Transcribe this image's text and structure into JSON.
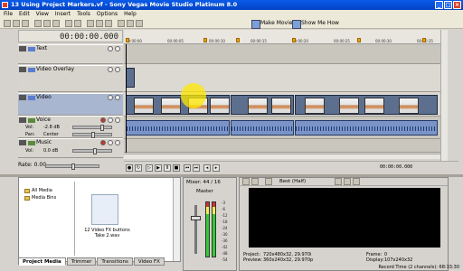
{
  "window": {
    "title": "13 Using Project Markers.vf - Sony Vegas Movie Studio Platinum 8.0",
    "accent": "#0a5be8"
  },
  "menu": [
    "File",
    "Edit",
    "View",
    "Insert",
    "Tools",
    "Options",
    "Help"
  ],
  "toolbar": {
    "make_movie": "Make Movie",
    "show_me_how": "Show Me How"
  },
  "timecode": "00:00:00.000",
  "ruler_labels": [
    "00:00:00",
    "00:00:05",
    "00:00:10",
    "00:00:15",
    "00:00:20",
    "00:00:25",
    "00:00:30",
    "00:00:35"
  ],
  "tracks": [
    {
      "name": "Text",
      "type": "video"
    },
    {
      "name": "Video Overlay",
      "type": "video"
    },
    {
      "name": "Video",
      "type": "video"
    },
    {
      "name": "Voice",
      "type": "audio",
      "vol_label": "Vol:",
      "vol_value": "-2.8 dB",
      "pan_label": "Pan:",
      "pan_value": "Center"
    },
    {
      "name": "Music",
      "type": "audio",
      "vol_label": "Vol:",
      "vol_value": "0.0 dB"
    }
  ],
  "rate": "Rate: 0.00",
  "transport_time": "00:00:00.000",
  "media": {
    "tree": [
      "All Media",
      "Media Bins"
    ],
    "file_caption_1": "12 Video FX buttons",
    "file_caption_2": "Take 2.wav"
  },
  "mixer": {
    "title": "Mixer: 44 / 16",
    "master": "Master",
    "db_marks": [
      "-3",
      "-6",
      "-12",
      "-18",
      "-24",
      "-30",
      "-36",
      "-42",
      "-48",
      "-54"
    ]
  },
  "preview": {
    "quality": "Best (Half)",
    "project_label": "Project:",
    "project_value": "720x480x32, 29.970i",
    "preview_label": "Preview:",
    "preview_value": "360x240x32, 29.970p",
    "frame_label": "Frame:",
    "frame_value": "0",
    "display_label": "Display:",
    "display_value": "107x240x32"
  },
  "tabs": [
    "Project Media",
    "Trimmer",
    "Transitions",
    "Video FX"
  ],
  "status": "Record Time (2 channels): 68:33:30"
}
